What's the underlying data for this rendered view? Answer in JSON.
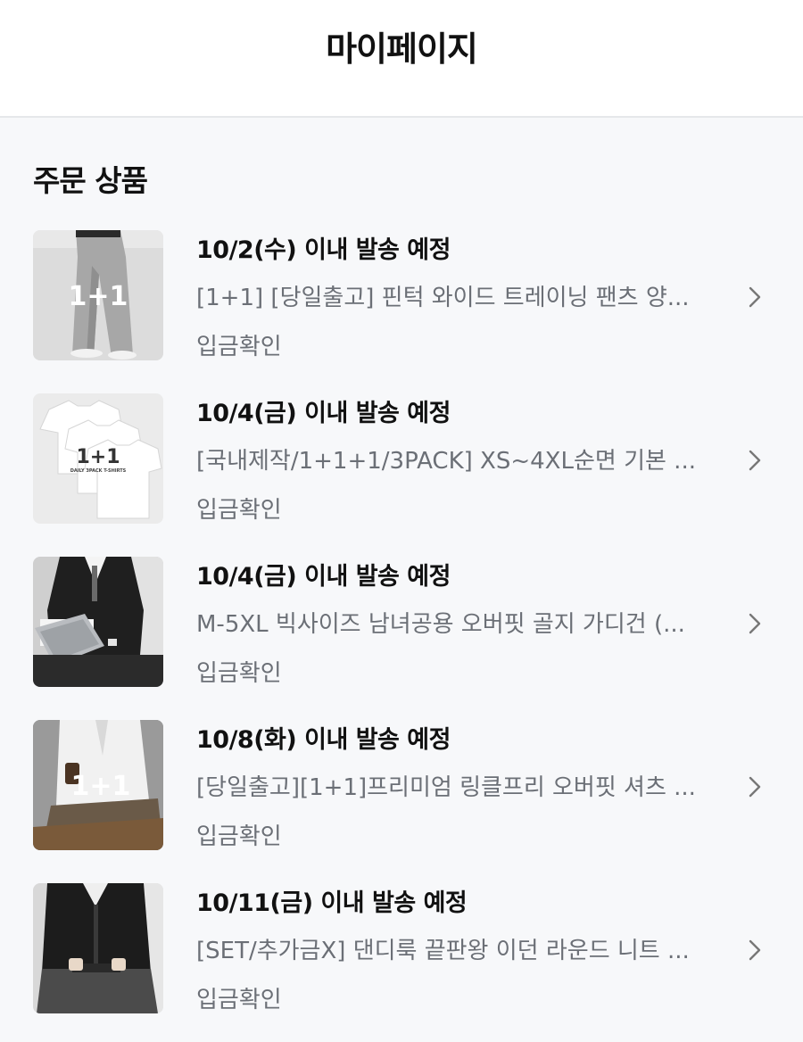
{
  "header": {
    "title": "마이페이지"
  },
  "section": {
    "title": "주문 상품"
  },
  "orders": [
    {
      "shipping": "10/2(수) 이내 발송 예정",
      "product": "[1+1] [당일출고] 핀턱 와이드 트레이닝 팬츠 양...",
      "status": "입금확인",
      "thumb_badge": "1+1",
      "thumb_sub": ""
    },
    {
      "shipping": "10/4(금) 이내 발송 예정",
      "product": "[국내제작/1+1+1/3PACK] XS~4XL순면 기본 ...",
      "status": "입금확인",
      "thumb_badge": "1+1",
      "thumb_sub": "DAILY 3PACK T-SHIRTS"
    },
    {
      "shipping": "10/4(금) 이내 발송 예정",
      "product": "M-5XL 빅사이즈 남녀공용 오버핏 골지 가디건 (...",
      "status": "입금확인",
      "thumb_badge": "",
      "thumb_sub": ""
    },
    {
      "shipping": "10/8(화) 이내 발송 예정",
      "product": "[당일출고][1+1]프리미엄 링클프리 오버핏 셔츠 ...",
      "status": "입금확인",
      "thumb_badge": "1+1",
      "thumb_sub": ""
    },
    {
      "shipping": "10/11(금) 이내 발송 예정",
      "product": "[SET/추가금X] 댄디룩 끝판왕 이던 라운드 니트 ...",
      "status": "입금확인",
      "thumb_badge": "",
      "thumb_sub": ""
    }
  ],
  "icons": {
    "row_arrow": "chevron-right-icon"
  },
  "colors": {
    "header_bg": "#ffffff",
    "page_bg": "#f7f8fa",
    "muted_text": "#6b6f76"
  }
}
